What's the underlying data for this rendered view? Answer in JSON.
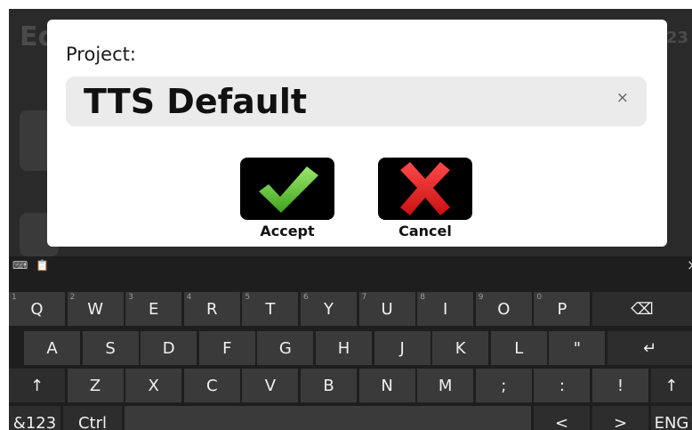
{
  "background_app": {
    "title_fragment": "Ec",
    "page_fragment": "/23"
  },
  "dialog": {
    "label": "Project:",
    "input_value": "TTS Default",
    "clear_glyph": "×",
    "accept_label": "Accept",
    "cancel_label": "Cancel",
    "accept_color": "#5fc232",
    "cancel_color": "#e02020"
  },
  "keyboard": {
    "tools": [
      "⌨",
      "📋",
      "×"
    ],
    "row1": [
      {
        "hint": "1",
        "label": "Q"
      },
      {
        "hint": "2",
        "label": "W"
      },
      {
        "hint": "3",
        "label": "E"
      },
      {
        "hint": "4",
        "label": "R"
      },
      {
        "hint": "5",
        "label": "T"
      },
      {
        "hint": "6",
        "label": "Y"
      },
      {
        "hint": "7",
        "label": "U"
      },
      {
        "hint": "8",
        "label": "I"
      },
      {
        "hint": "9",
        "label": "O"
      },
      {
        "hint": "0",
        "label": "P"
      },
      {
        "hint": "",
        "label": "⌫"
      }
    ],
    "row2": [
      "A",
      "S",
      "D",
      "F",
      "G",
      "H",
      "J",
      "K",
      "L",
      "\"",
      "↵"
    ],
    "row3": [
      "↑",
      "Z",
      "X",
      "C",
      "V",
      "B",
      "N",
      "M",
      ";",
      ":",
      "!",
      "↑"
    ],
    "row4": [
      "&123",
      "Ctrl",
      "",
      "<",
      ">",
      "ENG"
    ]
  }
}
